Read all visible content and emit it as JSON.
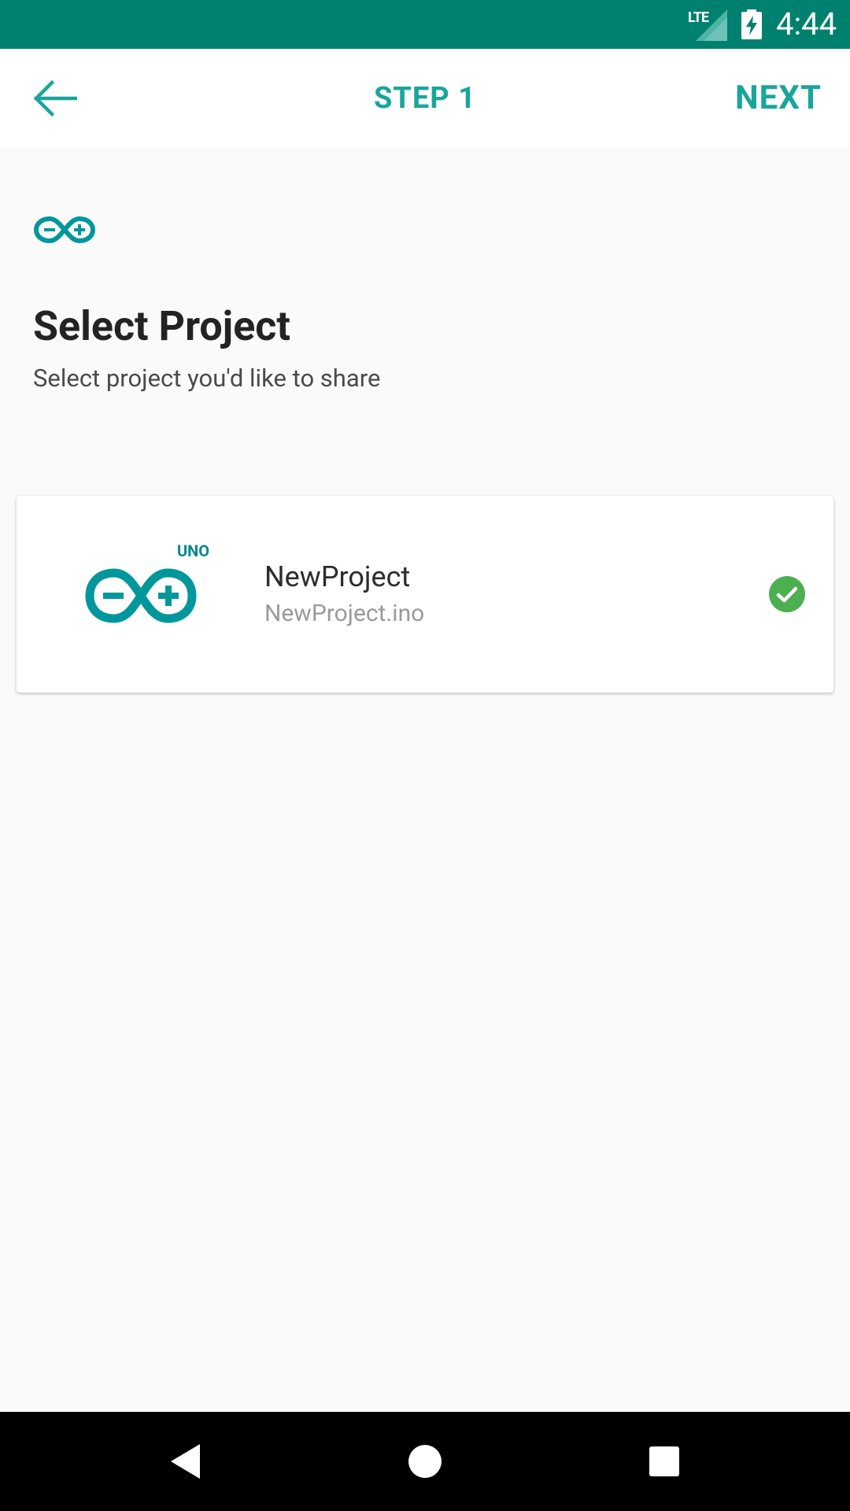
{
  "status_bar": {
    "network": "LTE",
    "time": "4:44"
  },
  "app_bar": {
    "title": "STEP 1",
    "next_label": "NEXT"
  },
  "page": {
    "title": "Select Project",
    "subtitle": "Select project you'd like to share"
  },
  "projects": [
    {
      "board": "UNO",
      "name": "NewProject",
      "file": "NewProject.ino",
      "selected": true
    }
  ],
  "colors": {
    "status_bar": "#00806f",
    "accent": "#1aa59a",
    "logo": "#00979c",
    "check": "#4caf50"
  },
  "icons": [
    "back-arrow-icon",
    "arduino-logo-icon",
    "check-circle-icon",
    "nav-back-icon",
    "nav-home-icon",
    "nav-recents-icon"
  ]
}
